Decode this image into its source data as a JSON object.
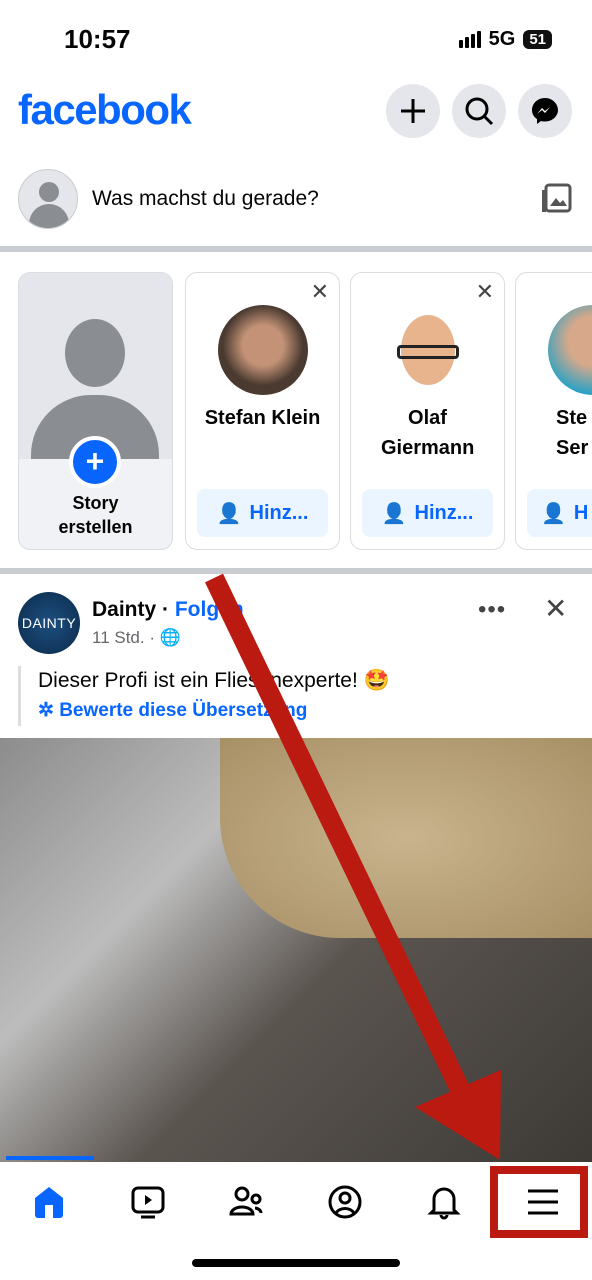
{
  "status": {
    "time": "10:57",
    "network": "5G",
    "battery": "51"
  },
  "header": {
    "logo": "facebook"
  },
  "composer": {
    "placeholder": "Was machst du gerade?"
  },
  "stories": {
    "create_label_line1": "Story",
    "create_label_line2": "erstellen",
    "cards": [
      {
        "name": "Stefan Klein",
        "button": "Hinz..."
      },
      {
        "name": "Olaf Giermann",
        "button": "Hinz..."
      },
      {
        "name": "Ste Ser",
        "button": "H"
      }
    ]
  },
  "post": {
    "author": "Dainty",
    "separator": " · ",
    "follow": "Folgen",
    "time": "11 Std. ·",
    "text": "Dieser Profi ist ein Fliesenexperte! 🤩",
    "translate": "Bewerte diese Übersetzung",
    "avatar_text": "DAINTY"
  },
  "nav": {
    "items": [
      "home",
      "video",
      "friends",
      "profile",
      "notifications",
      "menu"
    ],
    "active": "home"
  },
  "colors": {
    "brand": "#0866ff",
    "annotation": "#bb1a10"
  }
}
